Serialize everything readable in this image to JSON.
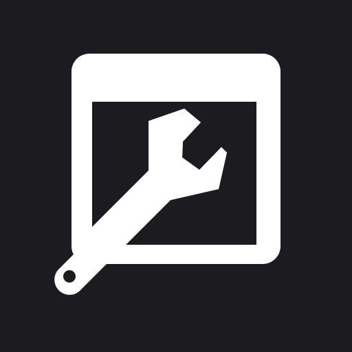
{
  "icon": {
    "name": "window-wrench-icon",
    "background_color": "#1c1b20",
    "foreground_color": "#ffffff"
  }
}
